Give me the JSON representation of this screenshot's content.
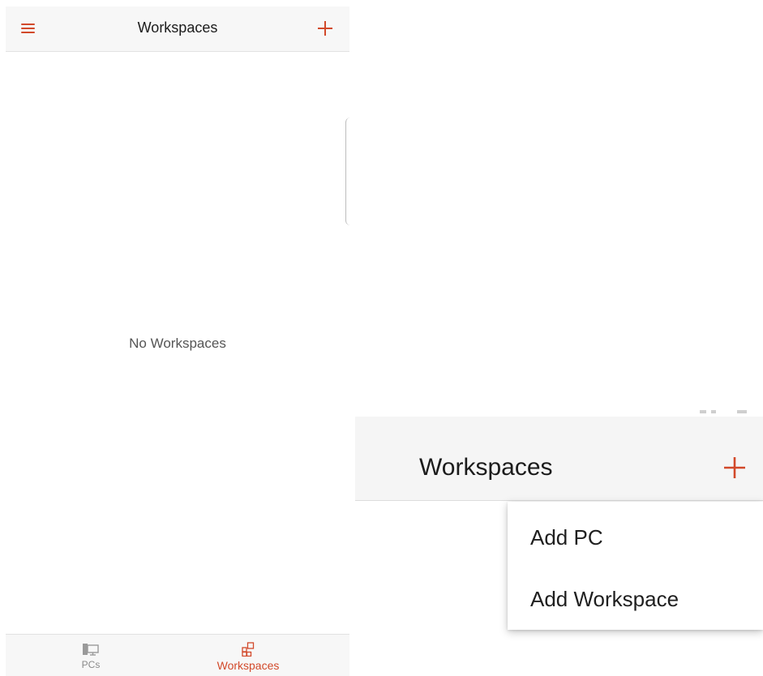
{
  "left_screen": {
    "header": {
      "title": "Workspaces"
    },
    "empty_state": "No Workspaces",
    "bottom_nav": {
      "items": [
        {
          "label": "PCs",
          "icon": "pc-monitor-icon",
          "active": false
        },
        {
          "label": "Workspaces",
          "icon": "workspaces-grid-icon",
          "active": true
        }
      ]
    }
  },
  "right_screen": {
    "header": {
      "title": "Workspaces"
    },
    "add_menu": {
      "items": [
        {
          "label": "Add PC"
        },
        {
          "label": "Add Workspace"
        }
      ]
    }
  },
  "colors": {
    "accent": "#d2492a",
    "header_bg": "#f7f7f7",
    "inactive": "#8a8a8a"
  }
}
